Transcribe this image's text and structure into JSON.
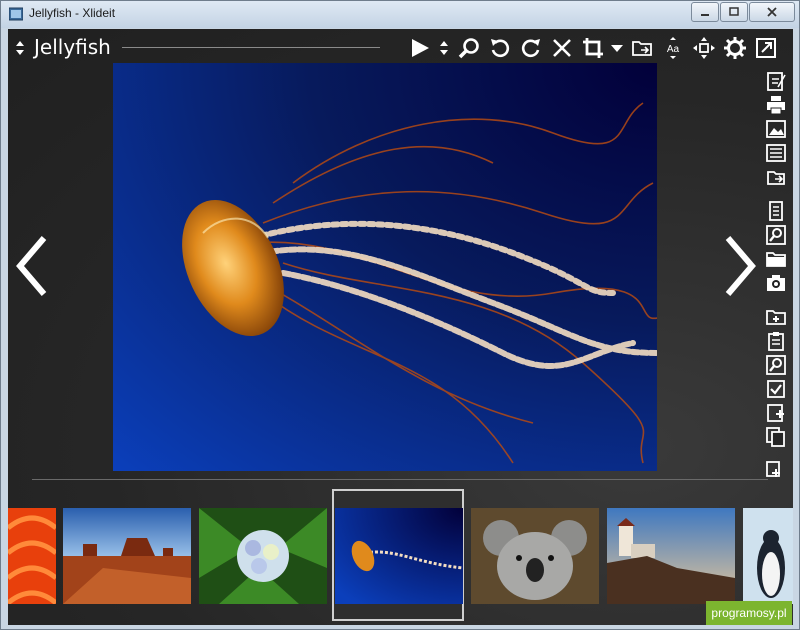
{
  "window": {
    "title": "Jellyfish - Xlideit"
  },
  "header": {
    "title": "Jellyfish"
  },
  "toolbar": {
    "icons": [
      "play-icon",
      "sort-icon",
      "zoom-icon",
      "rotate-left-icon",
      "rotate-right-icon",
      "delete-icon",
      "crop-icon",
      "dropdown-icon",
      "folder-move-icon",
      "text-size-icon",
      "fit-icon",
      "settings-icon",
      "external-icon"
    ],
    "text_size_label": "Aa"
  },
  "sidebar": {
    "icons": [
      "edit-icon",
      "print-icon",
      "image-icon",
      "list-icon",
      "export-icon",
      "page-icon",
      "search-icon",
      "folder-icon",
      "camera-icon",
      "add-folder-icon",
      "clipboard-icon",
      "find-icon",
      "checkbox-icon",
      "new-doc-icon",
      "copy-icon",
      "paste-icon"
    ]
  },
  "thumbnails": [
    {
      "name": "tulips",
      "colors": [
        "#ff5a14",
        "#b01f05"
      ]
    },
    {
      "name": "desert",
      "colors": [
        "#2f6db8",
        "#c05a1e"
      ]
    },
    {
      "name": "hydrangeas",
      "colors": [
        "#2f6b1e",
        "#c9d9e8"
      ]
    },
    {
      "name": "jellyfish",
      "colors": [
        "#02003a",
        "#0b3fbb"
      ],
      "selected": true
    },
    {
      "name": "koala",
      "colors": [
        "#6b5a3a",
        "#9a9a98"
      ]
    },
    {
      "name": "lighthouse",
      "colors": [
        "#4f86c8",
        "#5a3a2a"
      ]
    },
    {
      "name": "penguins",
      "colors": [
        "#d9e8f3",
        "#2a3a4a"
      ]
    }
  ],
  "badge": {
    "text": "programosy.pl"
  },
  "colors": {
    "accent": "#7cb52f",
    "title_bar": "#c3d3e4",
    "background": "#262626"
  }
}
